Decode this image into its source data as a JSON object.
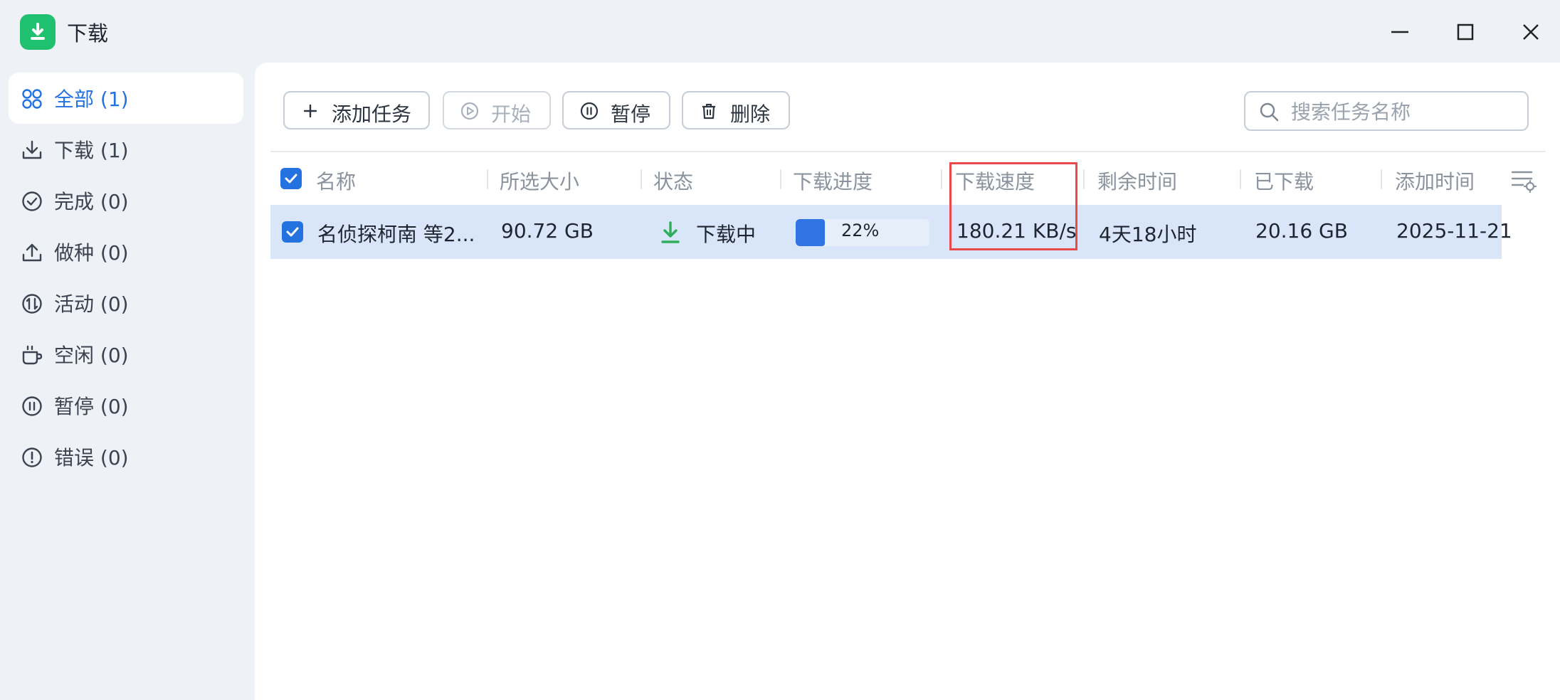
{
  "window": {
    "title": "下载",
    "controls": [
      "minimize-icon",
      "maximize-icon",
      "close-icon"
    ]
  },
  "sidebar": {
    "items": [
      {
        "label": "全部 (1)",
        "icon": "grid-icon",
        "active": true
      },
      {
        "label": "下载 (1)",
        "icon": "download-icon",
        "active": false
      },
      {
        "label": "完成 (0)",
        "icon": "check-circle-icon",
        "active": false
      },
      {
        "label": "做种 (0)",
        "icon": "upload-icon",
        "active": false
      },
      {
        "label": "活动 (0)",
        "icon": "activity-icon",
        "active": false
      },
      {
        "label": "空闲 (0)",
        "icon": "cup-icon",
        "active": false
      },
      {
        "label": "暂停 (0)",
        "icon": "pause-circle-icon",
        "active": false
      },
      {
        "label": "错误 (0)",
        "icon": "error-circle-icon",
        "active": false
      }
    ]
  },
  "toolbar": {
    "add_label": "添加任务",
    "start_label": "开始",
    "pause_label": "暂停",
    "delete_label": "删除",
    "search_placeholder": "搜索任务名称"
  },
  "table": {
    "columns": [
      "名称",
      "所选大小",
      "状态",
      "下载进度",
      "下载速度",
      "剩余时间",
      "已下载",
      "添加时间"
    ],
    "rows": [
      {
        "name": "名侦探柯南 等2...",
        "size": "90.72 GB",
        "status": "下载中",
        "progress_text": "22%",
        "progress": 0.22,
        "speed": "180.21 KB/s",
        "remaining": "4天18小时",
        "downloaded": "20.16 GB",
        "added": "2025-11-21"
      }
    ]
  },
  "colors": {
    "accent": "#2472e0",
    "app_icon": "#1fc06f",
    "status_green": "#2fae5a",
    "highlight": "#e9494a",
    "selected_row": "#d9e6fa"
  }
}
